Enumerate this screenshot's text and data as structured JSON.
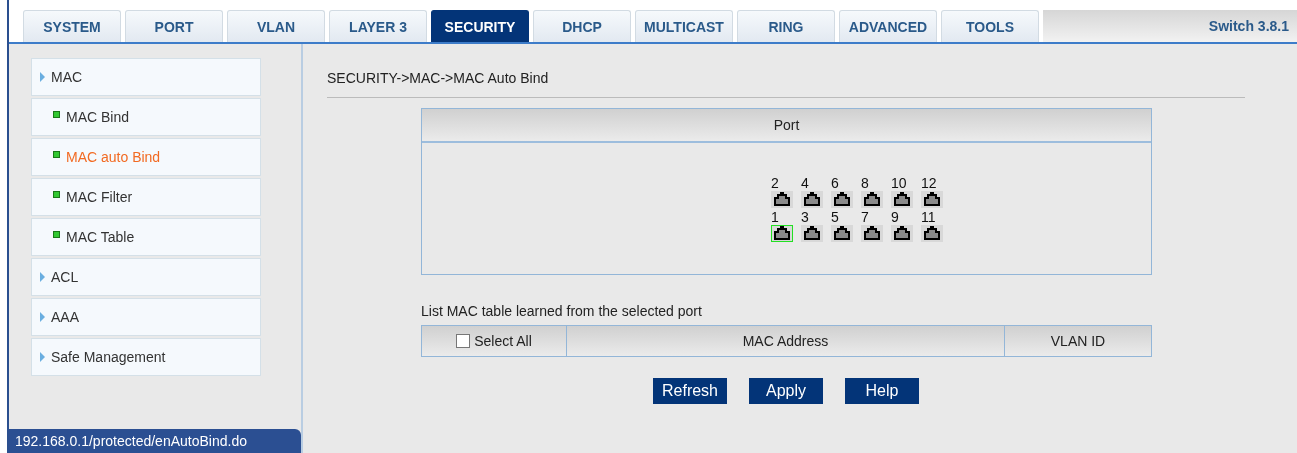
{
  "tabs": [
    {
      "label": "SYSTEM",
      "selected": false
    },
    {
      "label": "PORT",
      "selected": false
    },
    {
      "label": "VLAN",
      "selected": false
    },
    {
      "label": "LAYER 3",
      "selected": false
    },
    {
      "label": "SECURITY",
      "selected": true
    },
    {
      "label": "DHCP",
      "selected": false
    },
    {
      "label": "MULTICAST",
      "selected": false
    },
    {
      "label": "RING",
      "selected": false
    },
    {
      "label": "ADVANCED",
      "selected": false
    },
    {
      "label": "TOOLS",
      "selected": false
    }
  ],
  "version": "Switch 3.8.1",
  "sidebar": {
    "items": [
      {
        "label": "MAC",
        "selected": false,
        "children": [
          {
            "label": "MAC Bind",
            "selected": false
          },
          {
            "label": "MAC auto Bind",
            "selected": true
          },
          {
            "label": "MAC Filter",
            "selected": false
          },
          {
            "label": "MAC Table",
            "selected": false
          }
        ]
      },
      {
        "label": "ACL",
        "selected": false
      },
      {
        "label": "AAA",
        "selected": false
      },
      {
        "label": "Safe Management",
        "selected": false
      }
    ]
  },
  "status_bar": "192.168.0.1/protected/enAutoBind.do",
  "breadcrumb": "SECURITY->MAC->MAC Auto Bind",
  "port_panel": {
    "title": "Port",
    "rows": [
      [
        {
          "label": "2",
          "selected": false
        },
        {
          "label": "4",
          "selected": false
        },
        {
          "label": "6",
          "selected": false
        },
        {
          "label": "8",
          "selected": false
        },
        {
          "label": "10",
          "selected": false
        },
        {
          "label": "12",
          "selected": false
        }
      ],
      [
        {
          "label": "1",
          "selected": true
        },
        {
          "label": "3",
          "selected": false
        },
        {
          "label": "5",
          "selected": false
        },
        {
          "label": "7",
          "selected": false
        },
        {
          "label": "9",
          "selected": false
        },
        {
          "label": "11",
          "selected": false
        }
      ]
    ]
  },
  "mac_table": {
    "caption": "List MAC table learned from the selected port",
    "select_all": {
      "label": "Select All",
      "checked": false
    },
    "columns": [
      "MAC Address",
      "VLAN ID"
    ]
  },
  "buttons": [
    "Refresh",
    "Apply",
    "Help"
  ]
}
